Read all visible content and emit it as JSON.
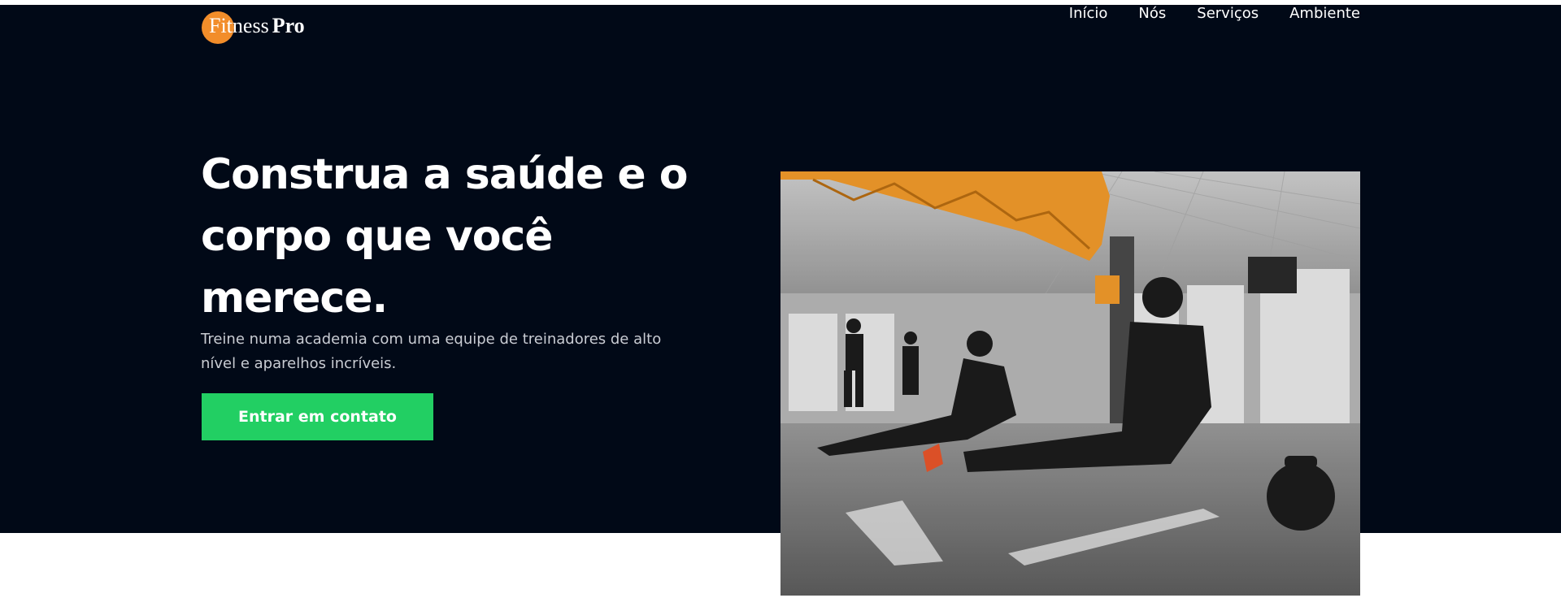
{
  "brand": {
    "part1": "Fitness",
    "part2": "Pro",
    "accent": "#f28d2a"
  },
  "nav": {
    "items": [
      "Início",
      "Nós",
      "Serviços",
      "Ambiente"
    ]
  },
  "hero": {
    "headline_line1": "Construa a saúde e o",
    "headline_line2": "corpo que você",
    "headline_line3": "merece.",
    "subtitle_line1": "Treine numa academia com uma equipe de treinadores de alto",
    "subtitle_line2": "nível e aparelhos incríveis.",
    "cta_label": "Entrar em contato",
    "cta_color": "#22cf63",
    "background": "#010917"
  },
  "image": {
    "alt": "gym-interior-photo"
  }
}
